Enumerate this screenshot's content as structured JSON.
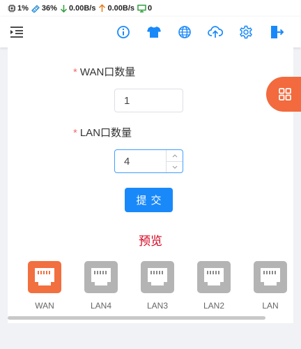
{
  "status_bar": {
    "cpu": "1%",
    "memory": "36%",
    "download_speed": "0.00B/s",
    "upload_speed": "0.00B/s",
    "devices": "0",
    "download_color": "#2e9e3a",
    "upload_color": "#e87a1a",
    "devices_color": "#2e9e3a"
  },
  "header": {
    "menu_icon": "menu-indent-icon",
    "icons": [
      "info-icon",
      "tshirt-icon",
      "globe-icon",
      "cloud-upload-icon",
      "gear-icon",
      "logout-icon"
    ],
    "icon_color": "#1989fa"
  },
  "form": {
    "wan_label": "WAN口数量",
    "wan_value": "1",
    "lan_label": "LAN口数量",
    "lan_value": "4",
    "required_mark": "*",
    "submit_label": "提交"
  },
  "preview": {
    "title": "预览",
    "ports": [
      {
        "label": "WAN",
        "active": true
      },
      {
        "label": "LAN4",
        "active": false
      },
      {
        "label": "LAN3",
        "active": false
      },
      {
        "label": "LAN2",
        "active": false
      },
      {
        "label": "LAN",
        "active": false
      }
    ],
    "active_color": "#f26f3f",
    "inactive_color": "#b4b4b4"
  },
  "floating_button": {
    "icon": "grid-icon",
    "color": "#f26a3d"
  }
}
